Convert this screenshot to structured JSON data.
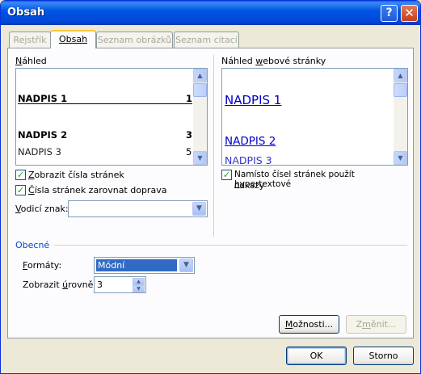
{
  "window": {
    "title": "Obsah",
    "help": "?",
    "close": "✕"
  },
  "tabs": [
    {
      "label": "Rejstřík",
      "active": false
    },
    {
      "label": "Obsah",
      "active": true
    },
    {
      "label": "Seznam obrázků",
      "active": false
    },
    {
      "label": "Seznam citací",
      "active": false
    }
  ],
  "print_preview": {
    "label_pre": "",
    "label_key": "N",
    "label_post": "áhled",
    "entries": [
      {
        "text": "NADPIS 1",
        "page": "1"
      },
      {
        "text": "NADPIS 2",
        "page": "3"
      },
      {
        "text": "NADPIS 3",
        "page": "5"
      }
    ]
  },
  "web_preview": {
    "label_pre": "Náhled ",
    "label_key": "w",
    "label_post": "ebové stránky",
    "entries": [
      "NADPIS 1",
      "NADPIS 2",
      "NADPIS 3"
    ]
  },
  "options": {
    "show_page_numbers": {
      "pre": "",
      "key": "Z",
      "post": "obrazit čísla stránek",
      "checked": true
    },
    "align_right": {
      "pre": "",
      "key": "Č",
      "post": "ísla stránek zarovnat doprava",
      "checked": true
    },
    "leader": {
      "pre": "",
      "key": "V",
      "post": "odicí znak:",
      "value": ""
    },
    "hyperlinks": {
      "pre": "Namísto čísel stránek použít ",
      "key": "h",
      "post": "ypertextové",
      "line2": "odkazy",
      "checked": true
    }
  },
  "general": {
    "heading": "Obecné",
    "formats": {
      "pre": "",
      "key": "F",
      "post": "ormáty:",
      "value": "Módní"
    },
    "levels": {
      "pre": "Zobrazit ",
      "key": "ú",
      "post": "rovně:",
      "value": "3"
    }
  },
  "buttons": {
    "options": {
      "pre": "",
      "key": "M",
      "post": "ožnosti..."
    },
    "modify": {
      "pre": "Z",
      "key": "m",
      "post": "ěnit..."
    },
    "ok": "OK",
    "cancel": "Storno"
  },
  "colors": {
    "accent": "#0046D6",
    "link": "#0000CC",
    "selection": "#316AC5",
    "check": "#21A121"
  }
}
